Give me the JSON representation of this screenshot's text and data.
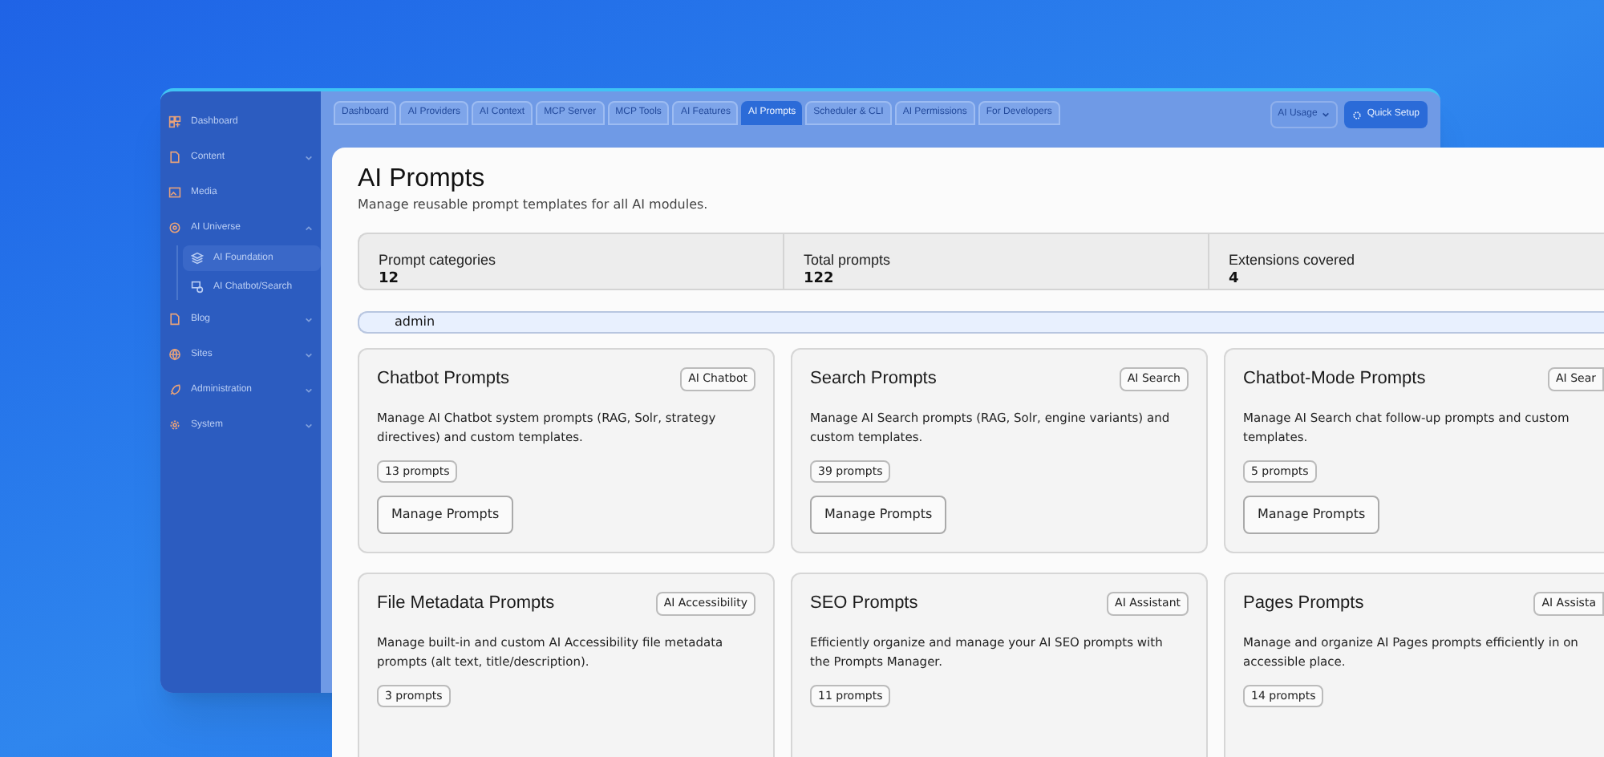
{
  "sidebar": {
    "items": [
      {
        "label": "Dashboard"
      },
      {
        "label": "Content",
        "expanded": false
      },
      {
        "label": "Media"
      },
      {
        "label": "AI Universe",
        "expanded": true,
        "children": [
          {
            "label": "AI Foundation",
            "selected": true
          },
          {
            "label": "AI Chatbot/Search",
            "selected": false
          }
        ]
      },
      {
        "label": "Blog",
        "expanded": false
      },
      {
        "label": "Sites",
        "expanded": false
      },
      {
        "label": "Administration",
        "expanded": false
      },
      {
        "label": "System",
        "expanded": false
      }
    ]
  },
  "tabs": [
    {
      "label": "Dashboard",
      "selected": false
    },
    {
      "label": "AI Providers",
      "selected": false
    },
    {
      "label": "AI Context",
      "selected": false
    },
    {
      "label": "MCP Server",
      "selected": false
    },
    {
      "label": "MCP Tools",
      "selected": false
    },
    {
      "label": "AI Features",
      "selected": false
    },
    {
      "label": "AI Prompts",
      "selected": true
    },
    {
      "label": "Scheduler & CLI",
      "selected": false
    },
    {
      "label": "AI Permissions",
      "selected": false
    },
    {
      "label": "For Developers",
      "selected": false
    }
  ],
  "usage_dropdown": {
    "value": "AI Usage"
  },
  "quick_setup_button": "Quick Setup",
  "page": {
    "title": "AI Prompts",
    "subtitle": "Manage reusable prompt templates for all AI modules.",
    "stats": [
      {
        "label": "Prompt categories",
        "value": "12"
      },
      {
        "label": "Total prompts",
        "value": "122"
      },
      {
        "label": "Extensions covered",
        "value": "4"
      }
    ],
    "user_bar": "admin",
    "cards": [
      {
        "title": "Chatbot Prompts",
        "tag": "AI Chatbot",
        "description": "Manage AI Chatbot system prompts (RAG, Solr, strategy directives) and custom templates.",
        "count": "13 prompts",
        "button": "Manage Prompts"
      },
      {
        "title": "Search Prompts",
        "tag": "AI Search",
        "description": "Manage AI Search prompts (RAG, Solr, engine variants) and custom templates.",
        "count": "39 prompts",
        "button": "Manage Prompts"
      },
      {
        "title": "Chatbot-Mode Prompts",
        "tag": "AI Sear",
        "description": "Manage AI Search chat follow-up prompts and custom templates.",
        "count": "5 prompts",
        "button": "Manage Prompts"
      },
      {
        "title": "File Metadata Prompts",
        "tag": "AI Accessibility",
        "description": "Manage built-in and custom AI Accessibility file metadata prompts (alt text, title/description).",
        "count": "3 prompts"
      },
      {
        "title": "SEO Prompts",
        "tag": "AI Assistant",
        "description": "Efficiently organize and manage your AI SEO prompts with the Prompts Manager.",
        "count": "11 prompts"
      },
      {
        "title": "Pages Prompts",
        "tag": "AI Assista",
        "description": "Manage and organize AI Pages prompts efficiently in on accessible place.",
        "count": "14 prompts"
      }
    ]
  }
}
